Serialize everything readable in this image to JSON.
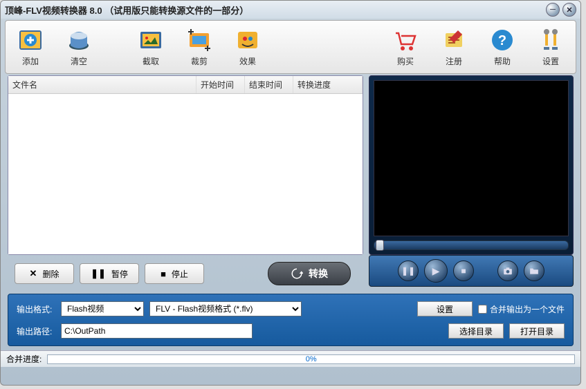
{
  "title": "顶峰-FLV视频转换器 8.0 （试用版只能转换源文件的一部分）",
  "toolbar": {
    "add": "添加",
    "clear": "清空",
    "capture": "截取",
    "crop": "裁剪",
    "effect": "效果",
    "buy": "购买",
    "register": "注册",
    "help": "帮助",
    "settings": "设置"
  },
  "columns": {
    "name": "文件名",
    "start": "开始时间",
    "end": "结束时间",
    "progress": "转换进度"
  },
  "buttons": {
    "delete": "删除",
    "pause": "暂停",
    "stop": "停止",
    "convert": "转换",
    "settings": "设置",
    "choose_dir": "选择目录",
    "open_dir": "打开目录"
  },
  "output": {
    "format_label": "输出格式:",
    "format_select1": "Flash视频",
    "format_select2": "FLV - Flash视频格式 (*.flv)",
    "merge_label": "合并输出为一个文件",
    "path_label": "输出路径:",
    "path_value": "C:\\OutPath"
  },
  "status": {
    "label": "合并进度:",
    "pct": "0%"
  },
  "icons": {
    "add": "add",
    "clear": "clear",
    "capture": "capture",
    "crop": "crop",
    "effect": "effect",
    "buy": "buy",
    "register": "register",
    "help": "help",
    "settings": "settings"
  }
}
